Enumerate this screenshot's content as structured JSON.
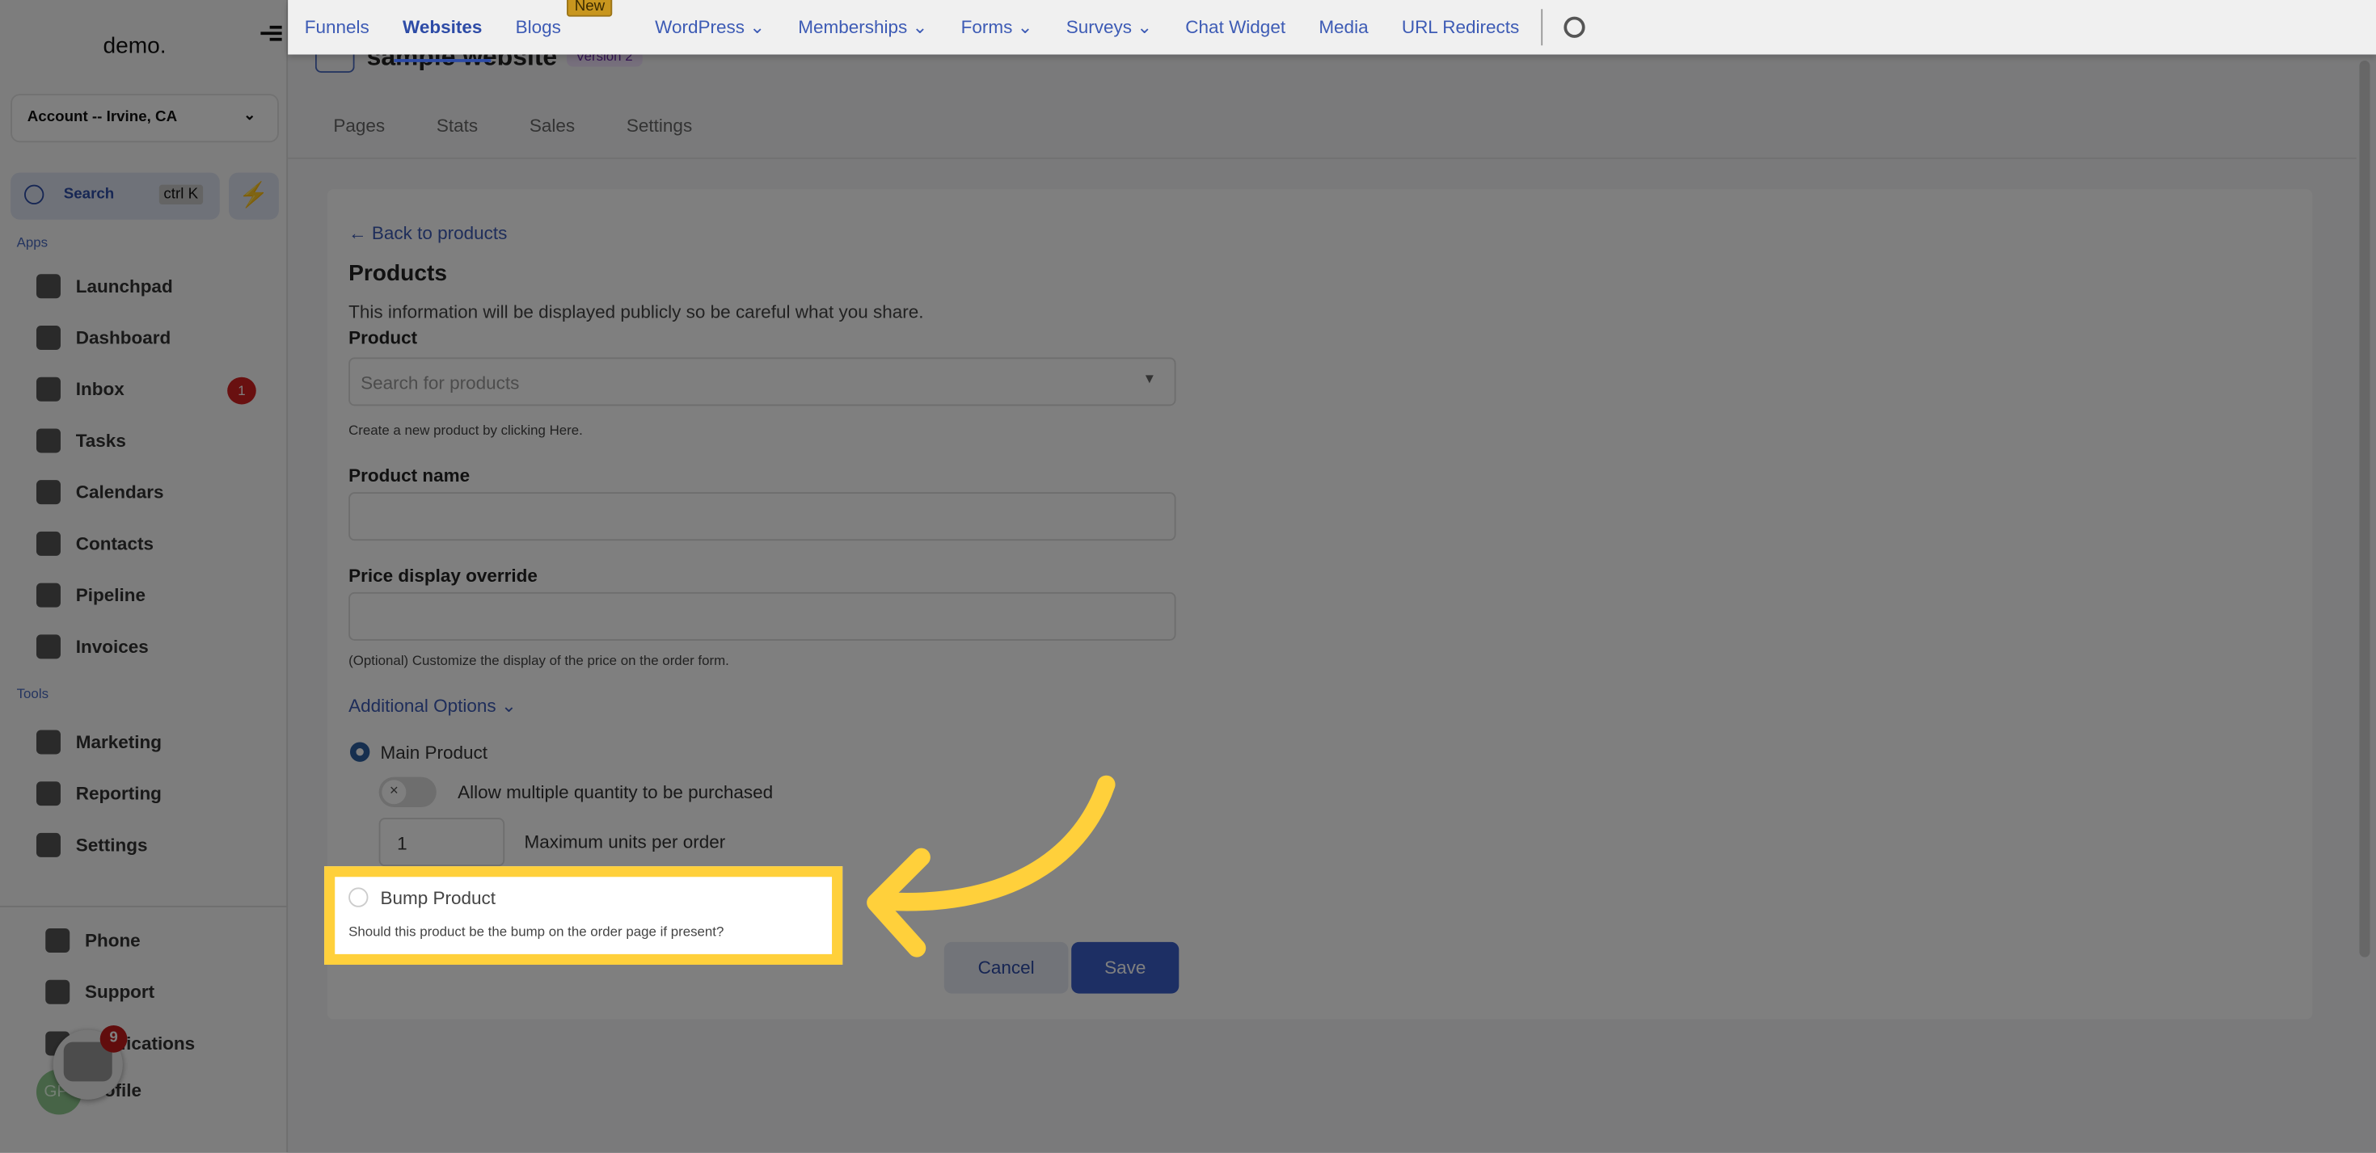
{
  "sidebar": {
    "logo": "demo.",
    "account": "Account -- Irvine, CA",
    "search_label": "Search",
    "search_shortcut": "ctrl K",
    "apps_label": "Apps",
    "tools_label": "Tools",
    "apps": [
      {
        "label": "Launchpad"
      },
      {
        "label": "Dashboard"
      },
      {
        "label": "Inbox",
        "badge": "1"
      },
      {
        "label": "Tasks"
      },
      {
        "label": "Calendars"
      },
      {
        "label": "Contacts"
      },
      {
        "label": "Pipeline"
      },
      {
        "label": "Invoices"
      }
    ],
    "tools": [
      {
        "label": "Marketing"
      },
      {
        "label": "Reporting"
      },
      {
        "label": "Settings"
      }
    ],
    "bottom": [
      {
        "label": "Phone"
      },
      {
        "label": "Support"
      },
      {
        "label": "Notifications"
      },
      {
        "label": "Profile"
      }
    ],
    "avatar_initials": "GP",
    "chat_badge": "9"
  },
  "topnav": {
    "items": [
      {
        "label": "Funnels"
      },
      {
        "label": "Websites",
        "active": true
      },
      {
        "label": "Blogs",
        "badge": "New"
      },
      {
        "label": "WordPress ⌄"
      },
      {
        "label": "Memberships ⌄"
      },
      {
        "label": "Forms ⌄"
      },
      {
        "label": "Surveys ⌄"
      },
      {
        "label": "Chat Widget"
      },
      {
        "label": "Media"
      },
      {
        "label": "URL Redirects"
      }
    ]
  },
  "header": {
    "title": "sample website",
    "version": "Version 2"
  },
  "tabs": [
    {
      "label": "Pages"
    },
    {
      "label": "Stats"
    },
    {
      "label": "Sales"
    },
    {
      "label": "Settings"
    }
  ],
  "form": {
    "back": "Back to products",
    "heading": "Products",
    "description": "This information will be displayed publicly so be careful what you share.",
    "product_label": "Product",
    "product_placeholder": "Search for products",
    "create_hint": "Create a new product by clicking Here.",
    "name_label": "Product name",
    "price_label": "Price display override",
    "price_hint": "(Optional) Customize the display of the price on the order form.",
    "additional": "Additional Options",
    "main_product": "Main Product",
    "allow_multiple": "Allow multiple quantity to be purchased",
    "max_units_value": "1",
    "max_units_label": "Maximum units per order",
    "bump_product": "Bump Product",
    "bump_hint": "Should this product be the bump on the order page if present?",
    "cancel": "Cancel",
    "save": "Save"
  },
  "colors": {
    "highlight": "#ffd03b",
    "primary": "#2d4ba6"
  }
}
